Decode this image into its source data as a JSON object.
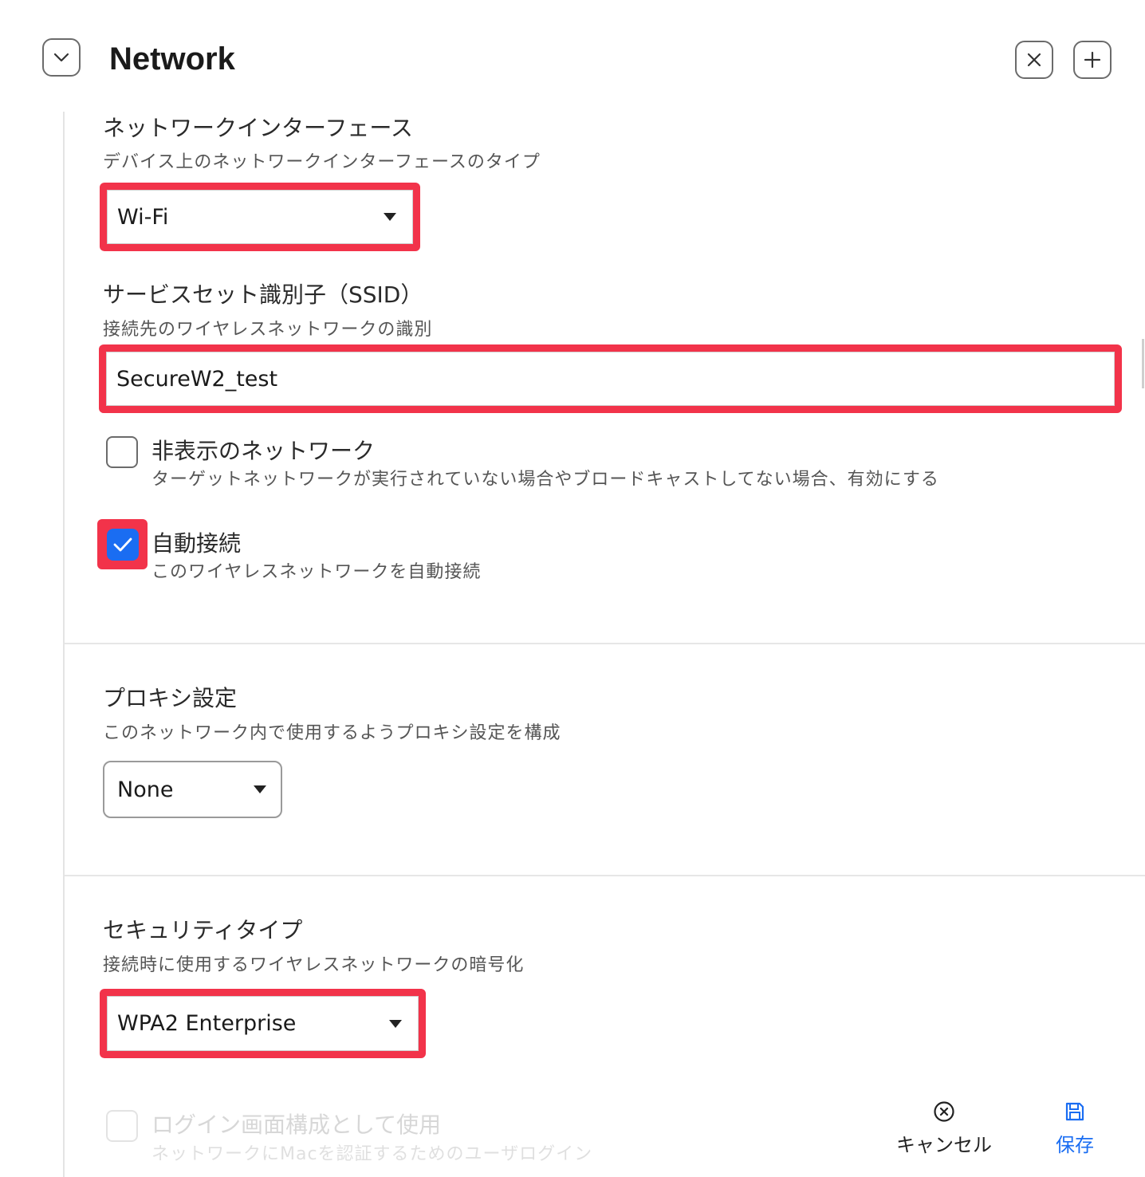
{
  "header": {
    "title": "Network"
  },
  "interface": {
    "label": "ネットワークインターフェース",
    "desc": "デバイス上のネットワークインターフェースのタイプ",
    "value": "Wi-Fi"
  },
  "ssid": {
    "label": "サービスセット識別子（SSID）",
    "desc": "接続先のワイヤレスネットワークの識別",
    "value": "SecureW2_test"
  },
  "hidden_network": {
    "label": "非表示のネットワーク",
    "desc": "ターゲットネットワークが実行されていない場合やブロードキャストしてない場合、有効にする",
    "checked": false
  },
  "auto_join": {
    "label": "自動接続",
    "desc": "このワイヤレスネットワークを自動接続",
    "checked": true
  },
  "proxy": {
    "label": "プロキシ設定",
    "desc": "このネットワーク内で使用するようプロキシ設定を構成",
    "value": "None"
  },
  "security": {
    "label": "セキュリティタイプ",
    "desc": "接続時に使用するワイヤレスネットワークの暗号化",
    "value": "WPA2 Enterprise"
  },
  "login_window": {
    "label": "ログイン画面構成として使用",
    "desc": "ネットワークにMacを認証するためのユーザログイン",
    "checked": false
  },
  "footer": {
    "cancel_label": "キャンセル",
    "save_label": "保存"
  },
  "colors": {
    "highlight": "#f2334a",
    "accent": "#1a6df2"
  }
}
